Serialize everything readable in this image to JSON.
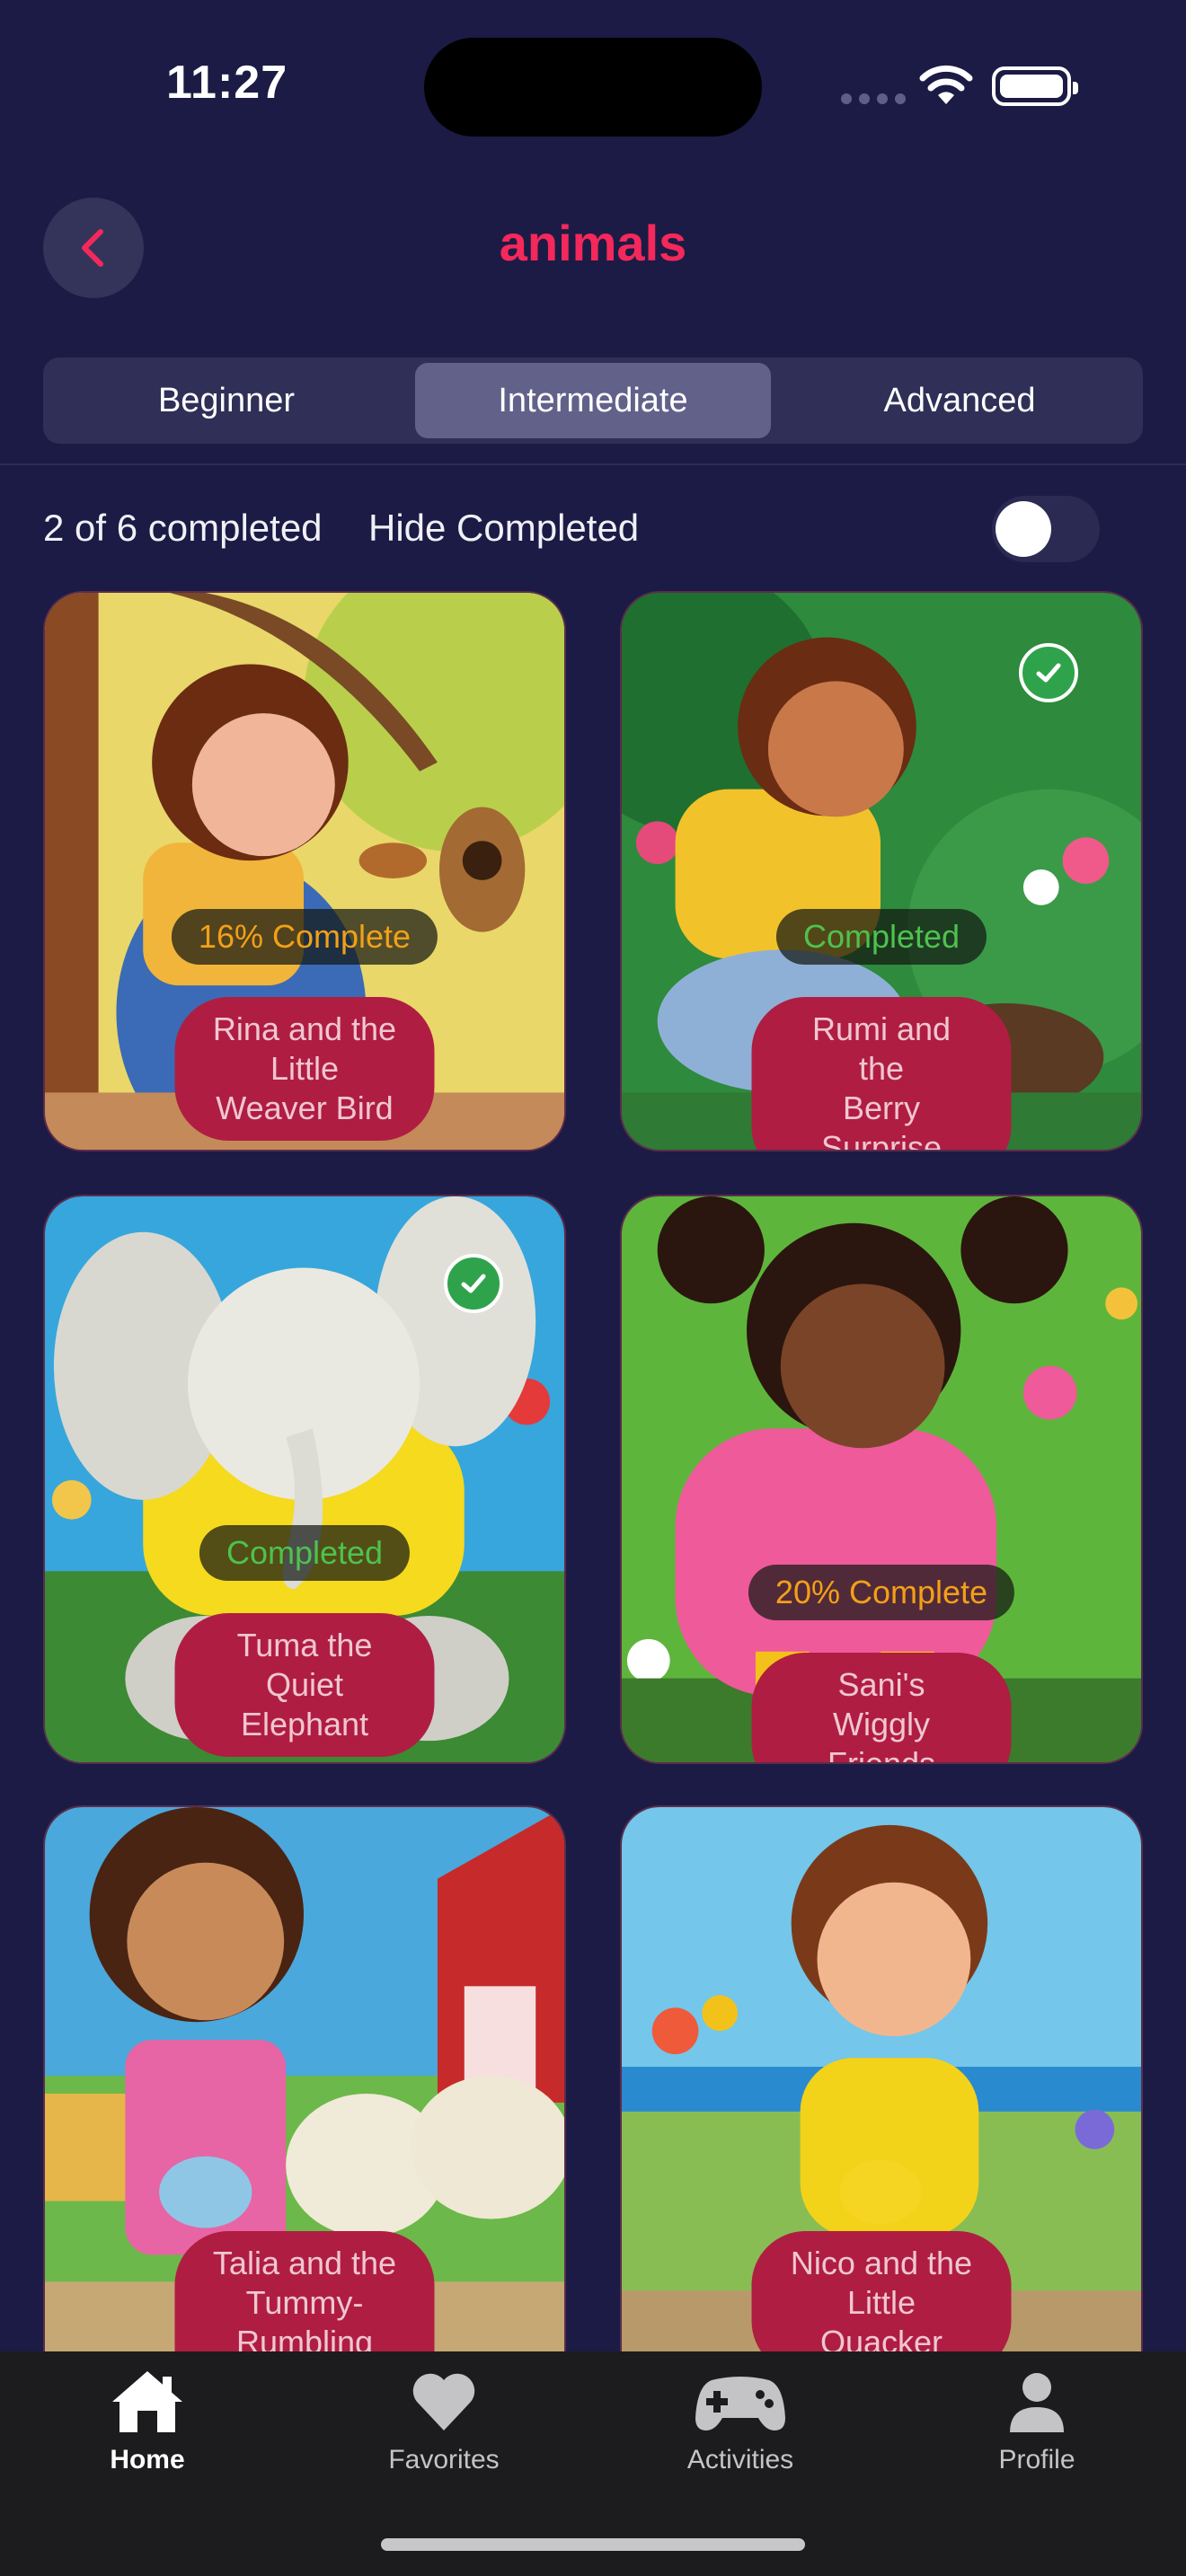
{
  "status_bar": {
    "time": "11:27"
  },
  "header": {
    "title": "animals",
    "back_icon": "chevron-left-icon"
  },
  "levels": {
    "items": [
      "Beginner",
      "Intermediate",
      "Advanced"
    ],
    "selected": "Intermediate"
  },
  "filter": {
    "completed_text": "2 of 6 completed",
    "hide_label": "Hide Completed",
    "hide_on": false
  },
  "stories": [
    {
      "title": "Rina and the Little\nWeaver Bird",
      "status": "16% Complete",
      "progress": 16,
      "completed": false
    },
    {
      "title": "Rumi and the\nBerry Surprise",
      "status": "Completed",
      "progress": 100,
      "completed": true
    },
    {
      "title": "Tuma the\nQuiet Elephant",
      "status": "Completed",
      "progress": 100,
      "completed": true
    },
    {
      "title": "Sani's Wiggly Friends",
      "status": "20% Complete",
      "progress": 20,
      "completed": false
    },
    {
      "title": "Talia and the Tummy-\nRumbling Goats",
      "status": "",
      "completed": false
    },
    {
      "title": "Nico and the\nLittle Quacker",
      "status": "",
      "completed": false
    }
  ],
  "tabbar": {
    "items": [
      {
        "label": "Home",
        "icon": "home-icon",
        "active": true
      },
      {
        "label": "Favorites",
        "icon": "heart-icon",
        "active": false
      },
      {
        "label": "Activities",
        "icon": "gamepad-icon",
        "active": false
      },
      {
        "label": "Profile",
        "icon": "person-icon",
        "active": false
      }
    ]
  },
  "colors": {
    "background": "#1c1b45",
    "accent": "#f4285b",
    "title_pill": "#b01d42",
    "progress": "#f3a018",
    "done": "#4ec24e"
  }
}
